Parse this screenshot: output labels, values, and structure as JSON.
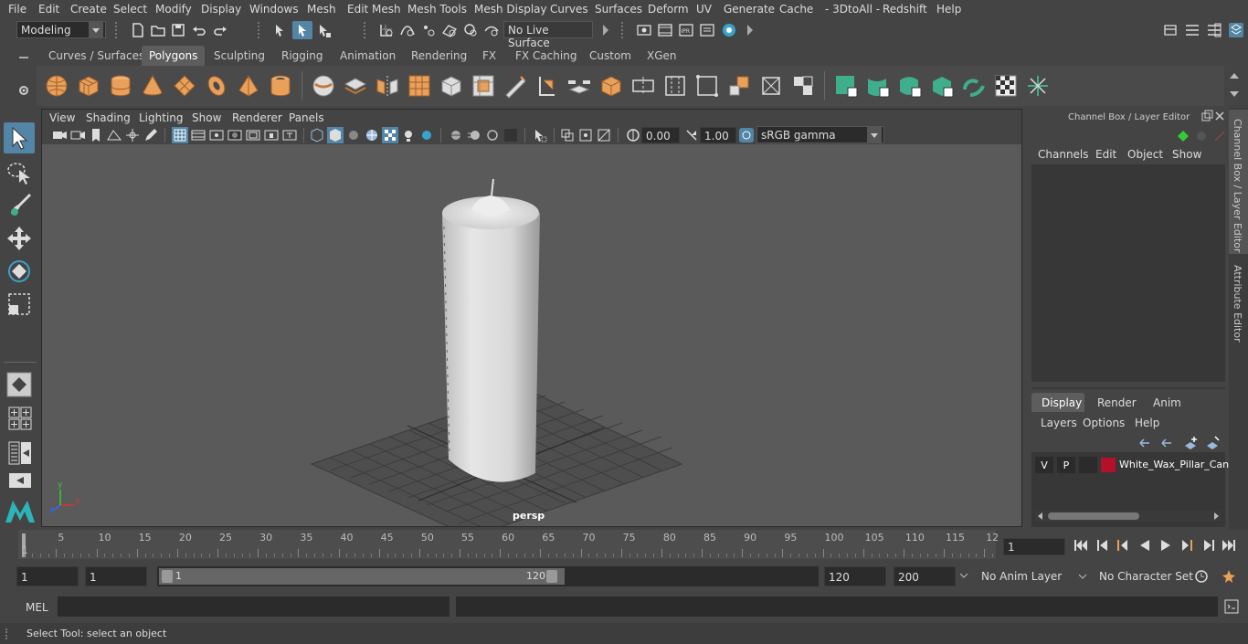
{
  "menu": [
    "File",
    "Edit",
    "Create",
    "Select",
    "Modify",
    "Display",
    "Windows",
    "Mesh",
    "Edit Mesh",
    "Mesh Tools",
    "Mesh Display",
    "Curves",
    "Surfaces",
    "Deform",
    "UV",
    "Generate",
    "Cache",
    "- 3DtoAll -",
    "Redshift",
    "Help"
  ],
  "toolbar": {
    "mode": "Modeling",
    "live_surface": "No Live Surface"
  },
  "shelf_tabs": [
    "Curves / Surfaces",
    "Polygons",
    "Sculpting",
    "Rigging",
    "Animation",
    "Rendering",
    "FX",
    "FX Caching",
    "Custom",
    "XGen"
  ],
  "shelf_active": "Polygons",
  "viewport": {
    "menu": [
      "View",
      "Shading",
      "Lighting",
      "Show",
      "Renderer",
      "Panels"
    ],
    "exposure": "0.00",
    "gamma": "1.00",
    "color_space": "sRGB gamma",
    "camera_label": "persp",
    "axis_labels": {
      "x": "x",
      "y": "y",
      "z": "z"
    }
  },
  "channel_box": {
    "title": "Channel Box / Layer Editor",
    "menu": [
      "Channels",
      "Edit",
      "Object",
      "Show"
    ]
  },
  "layer_editor": {
    "tabs": [
      "Display",
      "Render",
      "Anim"
    ],
    "active_tab": "Display",
    "menu": [
      "Layers",
      "Options",
      "Help"
    ],
    "layer": {
      "v": "V",
      "p": "P",
      "name": "White_Wax_Pillar_Can",
      "color": "#b3102a"
    }
  },
  "side_tabs": [
    "Channel Box / Layer Editor",
    "Attribute Editor"
  ],
  "timeline": {
    "labels": [
      "1",
      "5",
      "10",
      "15",
      "20",
      "25",
      "30",
      "35",
      "40",
      "45",
      "50",
      "55",
      "60",
      "65",
      "70",
      "75",
      "80",
      "85",
      "90",
      "95",
      "100",
      "105",
      "110",
      "115",
      "12"
    ],
    "current_frame": "1"
  },
  "range": {
    "start": "1",
    "anim_start": "1",
    "slider_start": "1",
    "slider_end": "120",
    "end": "120",
    "anim_end": "200",
    "anim_layer": "No Anim Layer",
    "char_set": "No Character Set"
  },
  "command_line": {
    "label": "MEL"
  },
  "status": {
    "text": "Select Tool: select an object"
  },
  "colors": {
    "accent": "#5285a6",
    "shelf_orange": "#e8a05a",
    "shelf_green": "#3fae8c"
  }
}
